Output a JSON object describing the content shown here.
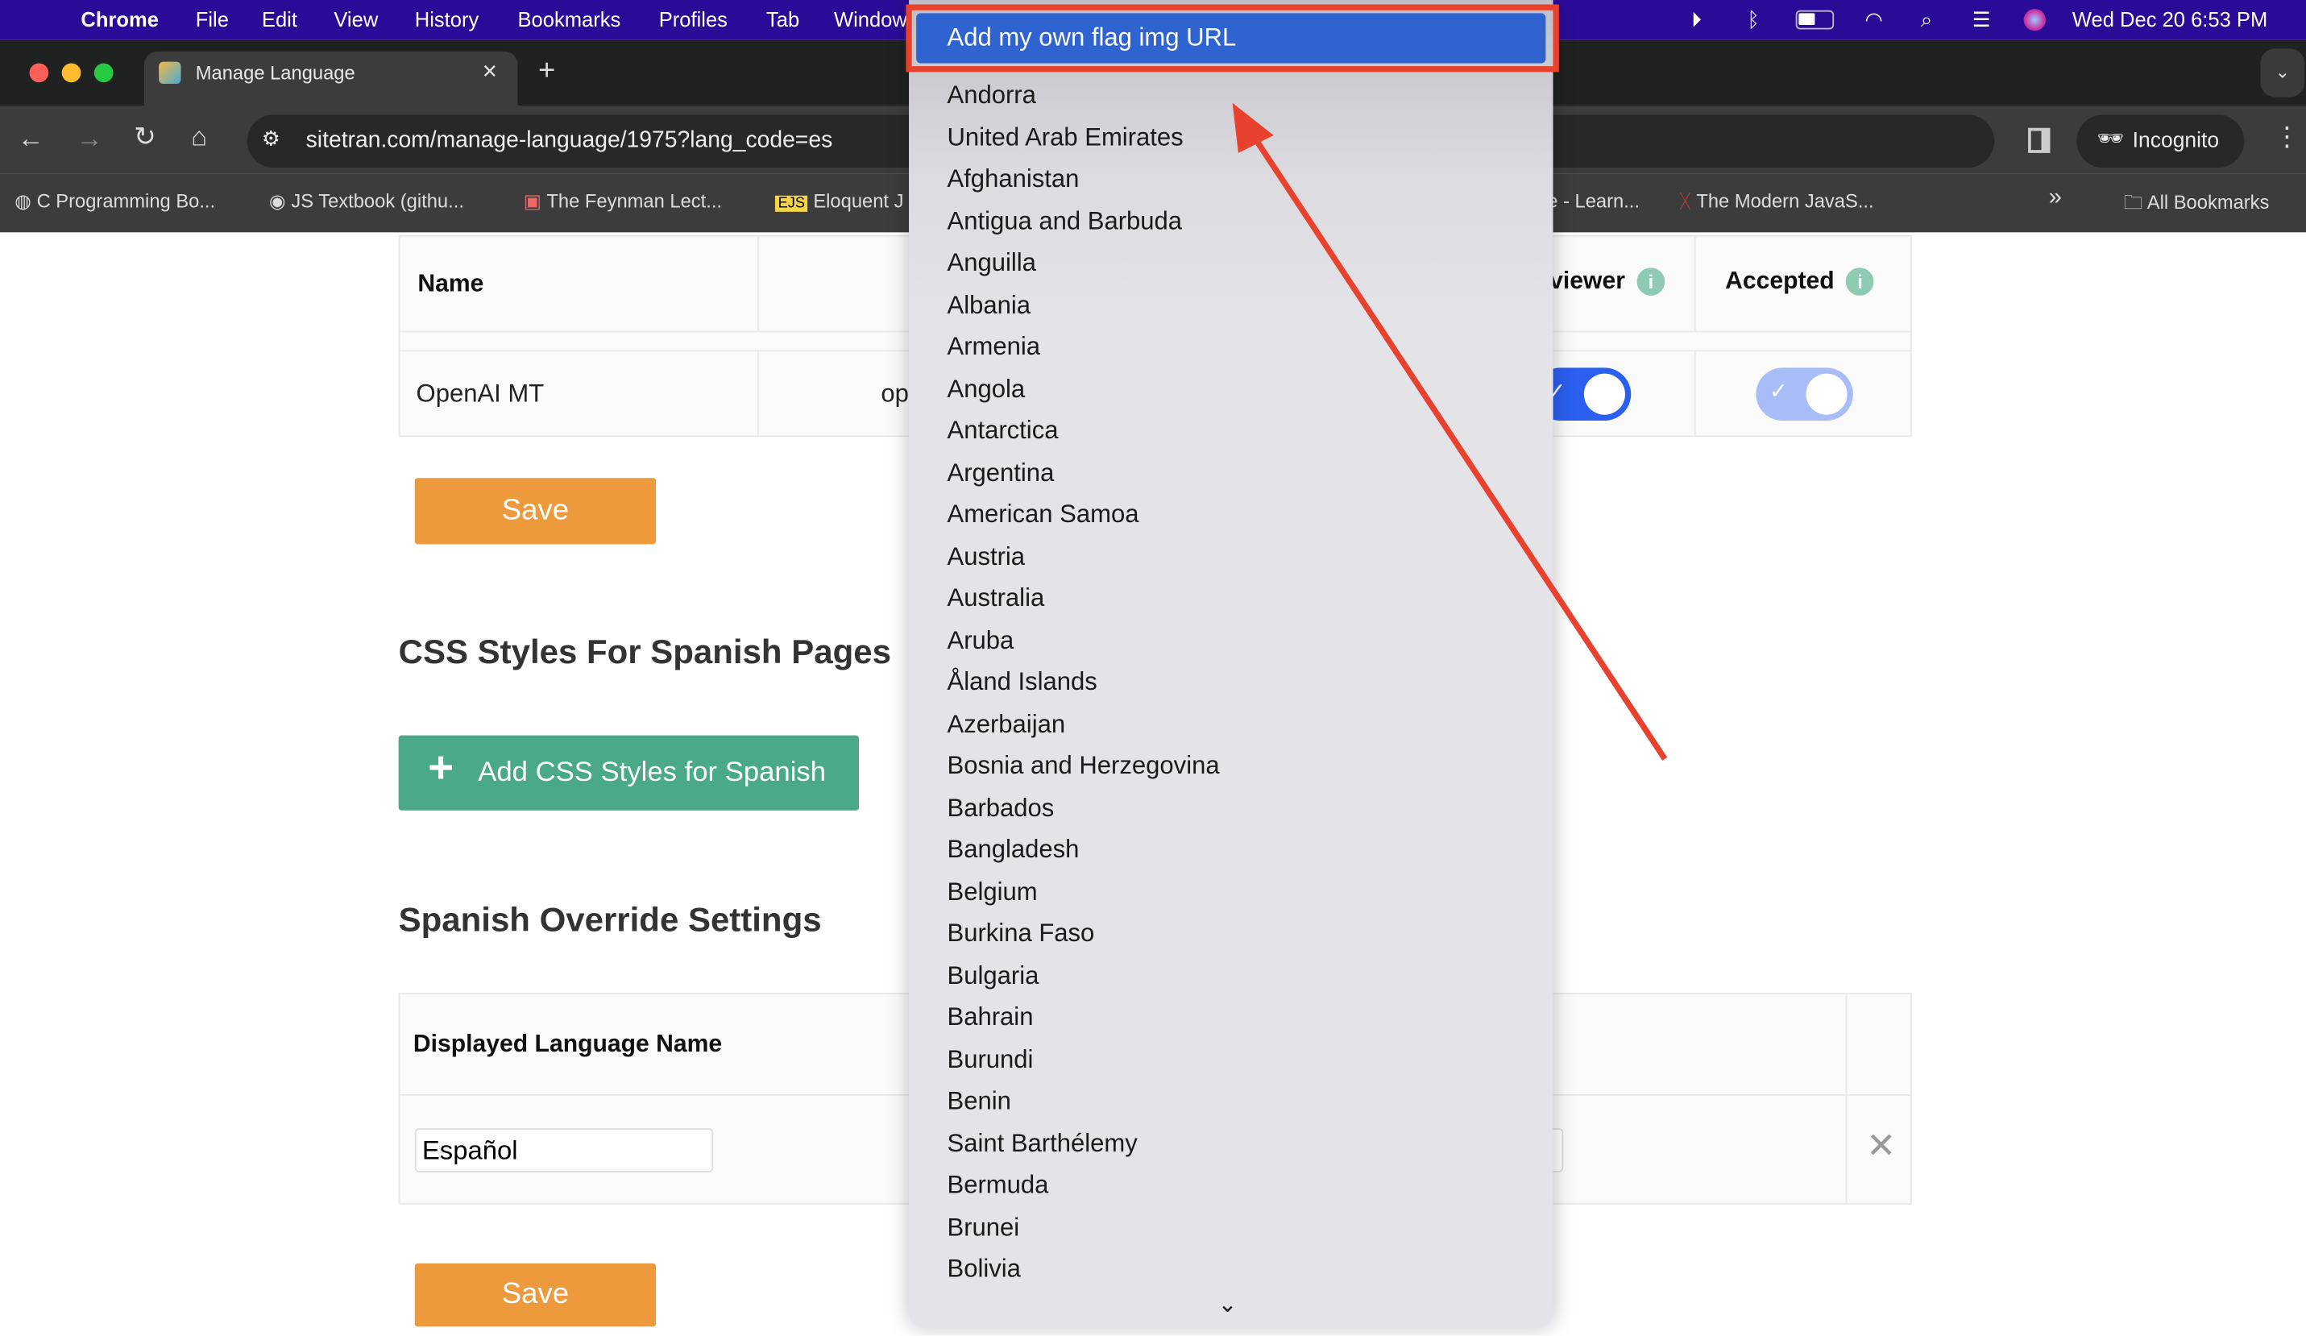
{
  "menubar": {
    "items": [
      "Chrome",
      "File",
      "Edit",
      "View",
      "History",
      "Bookmarks",
      "Profiles",
      "Tab",
      "Window"
    ],
    "clock": "Wed Dec 20  6:53 PM"
  },
  "tab": {
    "title": "Manage Language",
    "close": "×",
    "new_tab": "+"
  },
  "toolbar": {
    "url": "sitetran.com/manage-language/1975?lang_code=es",
    "incognito": "Incognito"
  },
  "bookmarks": {
    "items": [
      "C Programming Bo...",
      "JS Textbook (githu...",
      "The Feynman Lect...",
      "Eloquent J",
      "e - Learn...",
      "The Modern JavaS..."
    ],
    "more": "»",
    "all": "All Bookmarks"
  },
  "table1": {
    "headers": {
      "name": "Name",
      "reviewer": "Reviewer",
      "accepted": "Accepted"
    },
    "row": {
      "name": "OpenAI MT",
      "col2": "op",
      "reviewer_on": true,
      "accepted_on": true
    }
  },
  "save_label": "Save",
  "css_section": {
    "title": "CSS Styles For Spanish Pages",
    "button": "Add CSS Styles for Spanish"
  },
  "override": {
    "title": "Spanish Override Settings",
    "header": "Displayed Language Name",
    "value": "Español"
  },
  "dropdown": {
    "highlighted": "Add my own flag img URL",
    "options": [
      "Andorra",
      "United Arab Emirates",
      "Afghanistan",
      "Antigua and Barbuda",
      "Anguilla",
      "Albania",
      "Armenia",
      "Angola",
      "Antarctica",
      "Argentina",
      "American Samoa",
      "Austria",
      "Australia",
      "Aruba",
      "Åland Islands",
      "Azerbaijan",
      "Bosnia and Herzegovina",
      "Barbados",
      "Bangladesh",
      "Belgium",
      "Burkina Faso",
      "Bulgaria",
      "Bahrain",
      "Burundi",
      "Benin",
      "Saint Barthélemy",
      "Bermuda",
      "Brunei",
      "Bolivia"
    ]
  },
  "colors": {
    "menubar": "#2a0b98",
    "save": "#ec9a3c",
    "green": "#4aaa87",
    "toggle_on": "#2b5ff0",
    "toggle_light": "#a8bdf7",
    "highlight": "#2f64d0",
    "annotation": "#e8412e"
  }
}
